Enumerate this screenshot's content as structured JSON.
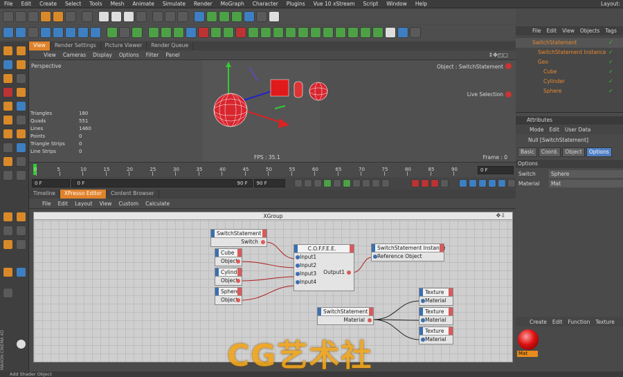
{
  "menubar": [
    "File",
    "Edit",
    "Create",
    "Select",
    "Tools",
    "Mesh",
    "Animate",
    "Simulate",
    "Render",
    "MoGraph",
    "Character",
    "Plugins",
    "Vue 10 xStream",
    "Script",
    "Window",
    "Help"
  ],
  "layout_label": "Layout:",
  "viewport": {
    "tabs": [
      "View",
      "Render Settings",
      "Picture Viewer",
      "Render Queue"
    ],
    "active_tab": "View",
    "menu": [
      "View",
      "Cameras",
      "Display",
      "Options",
      "Filter",
      "Panel"
    ],
    "label": "Perspective",
    "object_label": "Object : SwitchStatement",
    "live_selection": "Live Selection",
    "stats": [
      {
        "k": "Triangles",
        "v": "180"
      },
      {
        "k": "Quads",
        "v": "551"
      },
      {
        "k": "Lines",
        "v": "1460"
      },
      {
        "k": "Points",
        "v": "0"
      },
      {
        "k": "Triangle Strips",
        "v": "0"
      },
      {
        "k": "Line Strips",
        "v": "0"
      }
    ],
    "fps": "FPS : 35.1",
    "frame": "Frame : 0"
  },
  "timeline": {
    "ticks": [
      "0",
      "5",
      "10",
      "15",
      "20",
      "25",
      "30",
      "35",
      "40",
      "45",
      "50",
      "55",
      "60",
      "65",
      "70",
      "75",
      "80",
      "85",
      "90"
    ],
    "current_frame": "0 F",
    "start_field": "0 F",
    "min_field": "0 F",
    "max_field": "90 F",
    "end_field": "90 F"
  },
  "xpresso": {
    "tabs": [
      "Timeline",
      "XPresso Editor",
      "Content Browser"
    ],
    "active_tab": "XPresso Editor",
    "menu": [
      "File",
      "Edit",
      "Layout",
      "View",
      "Custom",
      "Calculate"
    ],
    "group_title": "XGroup",
    "nodes": {
      "switch1": {
        "title": "SwitchStatement",
        "port": "Switch"
      },
      "cube": {
        "title": "Cube",
        "port": "Object"
      },
      "cylinder": {
        "title": "Cylinder",
        "port": "Object"
      },
      "sphere": {
        "title": "Sphere",
        "port": "Object"
      },
      "coffee": {
        "title": "C.O.F.F.E.E.",
        "inputs": [
          "Input1",
          "Input2",
          "Input3",
          "Input4"
        ],
        "output": "Output1"
      },
      "instance": {
        "title": "SwitchStatement Instance",
        "port": "Reference Object"
      },
      "switch2": {
        "title": "SwitchStatement",
        "port": "Material"
      },
      "tex1": {
        "title": "Texture",
        "port": "Material"
      },
      "tex2": {
        "title": "Texture",
        "port": "Material"
      },
      "tex3": {
        "title": "Texture",
        "port": "Material"
      }
    }
  },
  "object_manager": {
    "menu": [
      "File",
      "Edit",
      "View",
      "Objects",
      "Tags"
    ],
    "rows": [
      {
        "name": "SwitchStatement",
        "indent": 0
      },
      {
        "name": "SwitchStatement Instance",
        "indent": 1
      },
      {
        "name": "Geo",
        "indent": 1
      },
      {
        "name": "Cube",
        "indent": 2
      },
      {
        "name": "Cylinder",
        "indent": 2
      },
      {
        "name": "Sphere",
        "indent": 2
      }
    ]
  },
  "attributes": {
    "header": "Attributes",
    "menu": [
      "Mode",
      "Edit",
      "User Data"
    ],
    "object": "Null [SwitchStatement]",
    "tabs": [
      "Basic",
      "Coord.",
      "Object",
      "Options"
    ],
    "active_tab": "Options",
    "section": "Options",
    "fields": [
      {
        "label": "Switch",
        "value": "Sphere"
      },
      {
        "label": "Material",
        "value": "Mat"
      }
    ]
  },
  "material_manager": {
    "menu": [
      "Create",
      "Edit",
      "Function",
      "Texture"
    ],
    "material": "Mat"
  },
  "watermark": "CG艺术社",
  "brand_side": "MAXON CINEMA 4D",
  "status": "Add Shader Object",
  "colors": {
    "accent": "#e0822a",
    "selection": "#4f7fc4",
    "port_in": "#3b6fb0",
    "port_out": "#d85b5b"
  }
}
